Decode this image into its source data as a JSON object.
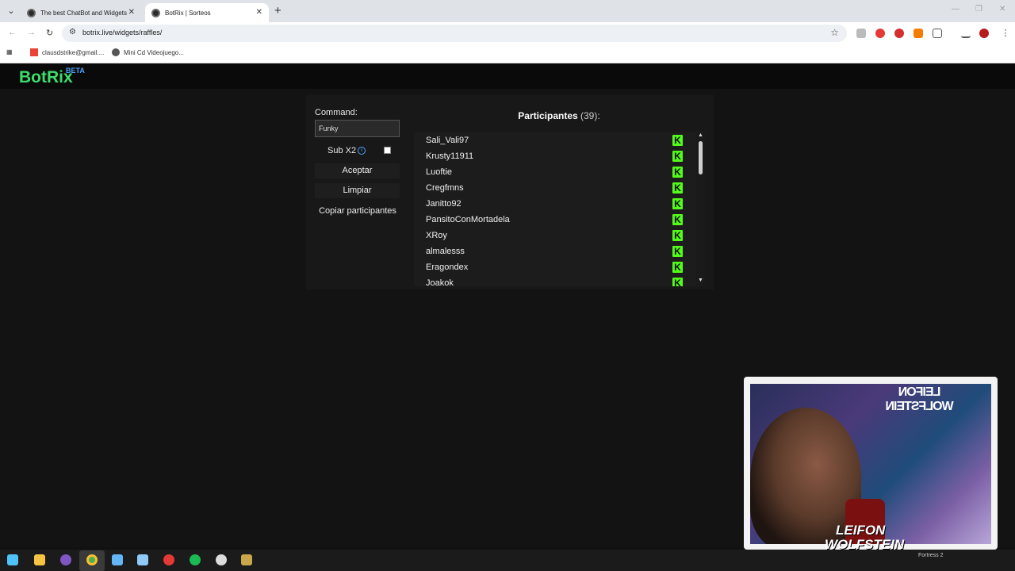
{
  "browser": {
    "tabs": [
      {
        "title": "The best ChatBot and Widgets",
        "active": false
      },
      {
        "title": "BotRix | Sorteos",
        "active": true
      }
    ],
    "url": "botrix.live/widgets/raffles/",
    "bookmarks": [
      {
        "label": "clausdstrike@gmail...."
      },
      {
        "label": "Mini Cd Videojuego..."
      }
    ]
  },
  "site": {
    "logo": "BotRix",
    "badge": "BETA"
  },
  "raffle": {
    "command_label": "Command:",
    "command_value": "Funky",
    "sub_x2_label": "Sub X2",
    "sub_x2_checked": false,
    "buttons": {
      "accept": "Aceptar",
      "clear": "Limpiar",
      "copy": "Copiar participantes"
    },
    "participants_title": "Participantes",
    "participants_count": "(39):",
    "participants": [
      "Sali_Vali97",
      "Krusty11911",
      "Luoftie",
      "Cregfmns",
      "Janitto92",
      "PansitoConMortadela",
      "XRoy",
      "almalesss",
      "Eragondex",
      "Joakok"
    ],
    "platform_icon": "kick-icon",
    "platform_color": "#53fc18"
  },
  "webcam": {
    "overlay_top": "LEIFON WOLFSTEIN",
    "overlay_bottom_line1": "LEIFON",
    "overlay_bottom_line2": "WOLFSTEIN",
    "game_label": "Fortress 2"
  },
  "colors": {
    "logo": "#3ddc6b",
    "beta": "#4da3ff",
    "kick": "#53fc18"
  }
}
